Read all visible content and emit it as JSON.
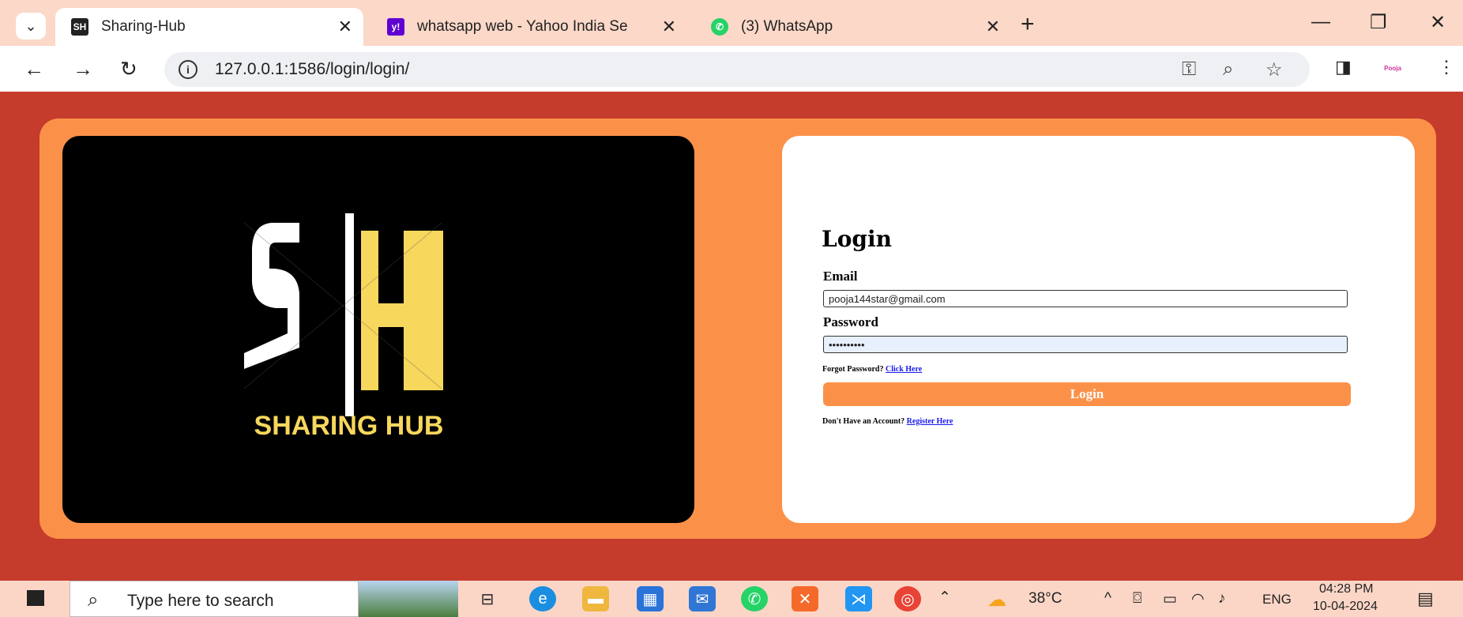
{
  "browser": {
    "tabs": [
      {
        "title": "Sharing-Hub",
        "favicon": "sharing-hub-favicon"
      },
      {
        "title": "whatsapp web - Yahoo India Se",
        "favicon": "yahoo-favicon"
      },
      {
        "title": "(3) WhatsApp",
        "favicon": "whatsapp-favicon"
      }
    ],
    "url": "127.0.0.1:1586/login/login/",
    "profile_label": "Pooja"
  },
  "logo": {
    "brand_text": "SHARING HUB",
    "colors": {
      "accent": "#f7d75c",
      "background": "#000000",
      "letter": "#ffffff"
    }
  },
  "form": {
    "title": "Login",
    "email_label": "Email",
    "email_value": "pooja144star@gmail.com",
    "password_label": "Password",
    "password_value": "••••••••••",
    "forgot_text": "Forgot Password?",
    "forgot_link": "Click Here",
    "login_button": "Login",
    "register_text": "Don't Have an Account?",
    "register_link": "Register Here"
  },
  "colors": {
    "page_bg": "#c53b2c",
    "frame": "#fb9149",
    "button": "#fb9149",
    "link": "#1a1aee"
  },
  "taskbar": {
    "search_placeholder": "Type here to search",
    "weather": "38°C",
    "language": "ENG",
    "time": "04:28 PM",
    "date": "10-04-2024"
  }
}
